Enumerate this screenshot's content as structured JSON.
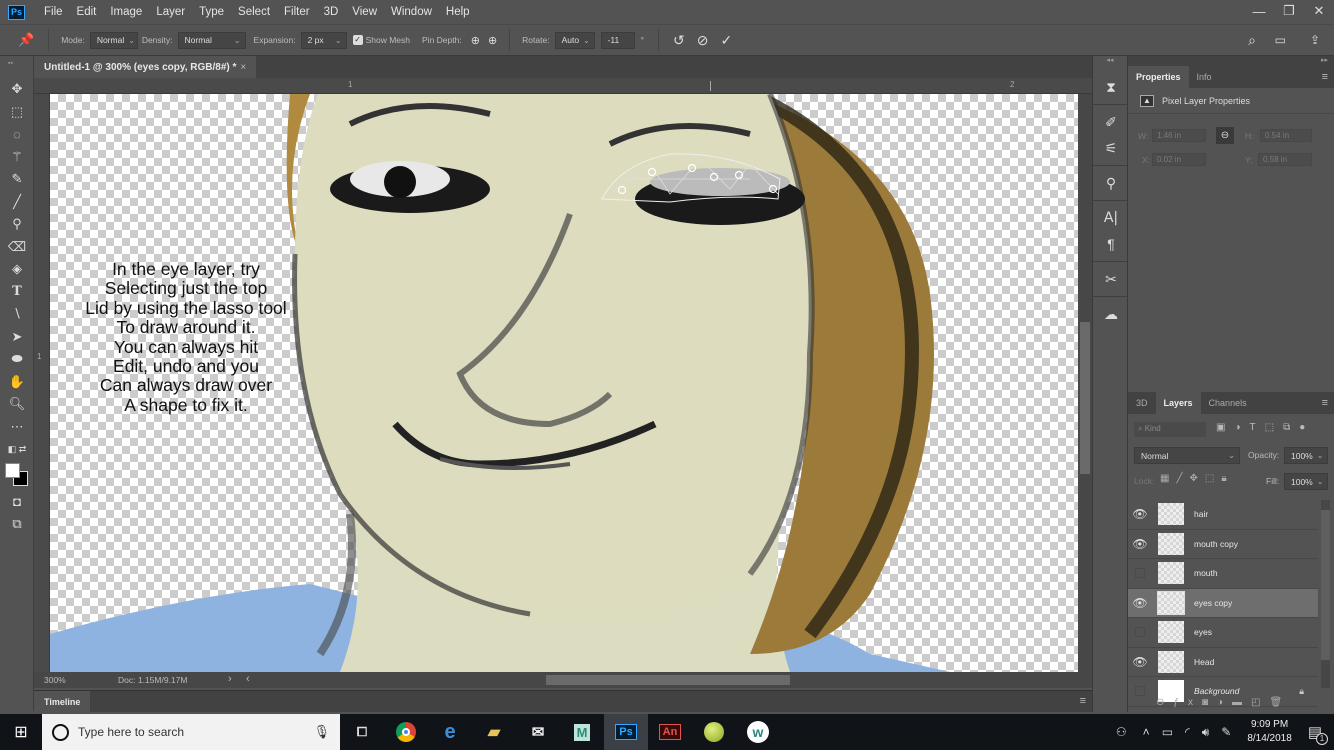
{
  "app": {
    "name": "Photoshop",
    "logo": "Ps"
  },
  "menu": [
    "File",
    "Edit",
    "Image",
    "Layer",
    "Type",
    "Select",
    "Filter",
    "3D",
    "View",
    "Window",
    "Help"
  ],
  "window_controls": {
    "minimize": "—",
    "restore": "❐",
    "close": "✕"
  },
  "options": {
    "mode_label": "Mode:",
    "mode_value": "Normal",
    "density_label": "Density:",
    "density_value": "Normal",
    "expansion_label": "Expansion:",
    "expansion_value": "2 px",
    "show_mesh_label": "Show Mesh",
    "show_mesh_checked": true,
    "pin_depth_label": "Pin Depth:",
    "rotate_label": "Rotate:",
    "rotate_value": "Auto",
    "rotate_angle": "-11",
    "degree": "°"
  },
  "document": {
    "tab_title": "Untitled-1 @ 300% (eyes copy, RGB/8#) *",
    "close": "×",
    "ruler_top": [
      "1",
      "2"
    ],
    "ruler_left": [
      "1"
    ],
    "note_lines": [
      "In the eye layer, try",
      "Selecting just the top",
      "Lid by using the lasso tool",
      "To draw around it.",
      "You can always hit",
      "Edit, undo and you",
      "Can always draw over",
      "A shape to fix it."
    ]
  },
  "status": {
    "zoom": "300%",
    "doc": "Doc: 1.15M/9.17M",
    "arrow": "›",
    "left_arrow": "‹"
  },
  "timeline": {
    "label": "Timeline"
  },
  "properties": {
    "tabs": [
      "Properties",
      "Info"
    ],
    "section": "Pixel Layer Properties",
    "w_label": "W:",
    "w_value": "1.46 in",
    "h_label": "H:",
    "h_value": "0.54 in",
    "x_label": "X:",
    "x_value": "0.02 in",
    "y_label": "Y:",
    "y_value": "0.58 in"
  },
  "layers_panel": {
    "tabs": [
      "3D",
      "Layers",
      "Channels"
    ],
    "kind_placeholder": "Kind",
    "blend_mode": "Normal",
    "opacity_label": "Opacity:",
    "opacity_value": "100%",
    "lock_label": "Lock:",
    "fill_label": "Fill:",
    "fill_value": "100%",
    "layers": [
      {
        "name": "hair",
        "visible": true,
        "selected": false
      },
      {
        "name": "mouth copy",
        "visible": true,
        "selected": false
      },
      {
        "name": "mouth",
        "visible": false,
        "selected": false
      },
      {
        "name": "eyes copy",
        "visible": true,
        "selected": true
      },
      {
        "name": "eyes",
        "visible": false,
        "selected": false
      },
      {
        "name": "Head",
        "visible": true,
        "selected": false
      },
      {
        "name": "Background",
        "visible": false,
        "selected": false,
        "locked": true
      }
    ]
  },
  "taskbar": {
    "search_placeholder": "Type here to search",
    "apps": [
      "task-view",
      "chrome",
      "edge",
      "file-explorer",
      "mail",
      "app-m",
      "photoshop",
      "animate",
      "app-green",
      "app-w"
    ],
    "ps_label": "Ps",
    "an_label": "An",
    "m_label": "M",
    "w_label": "w",
    "e_label": "e",
    "time": "9:09 PM",
    "date": "8/14/2018",
    "notification_count": "1"
  }
}
